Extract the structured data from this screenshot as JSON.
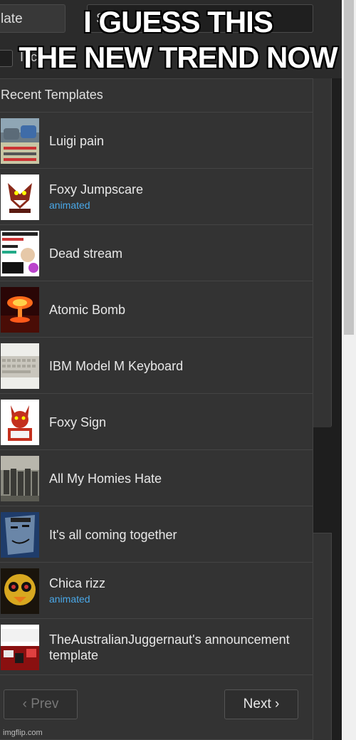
{
  "top": {
    "template_field_value": "late",
    "search_field_value": "S",
    "include_label": "Incl"
  },
  "caption": {
    "line1": "I GUESS THIS",
    "line2": "THE NEW TREND NOW"
  },
  "recent": {
    "heading": "Recent Templates",
    "items": [
      {
        "title": "Luigi pain",
        "sub": ""
      },
      {
        "title": "Foxy Jumpscare",
        "sub": "animated"
      },
      {
        "title": "Dead stream",
        "sub": ""
      },
      {
        "title": "Atomic Bomb",
        "sub": ""
      },
      {
        "title": "IBM Model M Keyboard",
        "sub": ""
      },
      {
        "title": "Foxy Sign",
        "sub": ""
      },
      {
        "title": "All My Homies Hate",
        "sub": ""
      },
      {
        "title": "It's all coming together",
        "sub": ""
      },
      {
        "title": "Chica rizz",
        "sub": "animated"
      },
      {
        "title": "TheAustralianJuggernaut's announcement template",
        "sub": ""
      }
    ]
  },
  "pager": {
    "prev_label": "‹ Prev",
    "next_label": "Next ›"
  },
  "watermark": "imgflip.com"
}
